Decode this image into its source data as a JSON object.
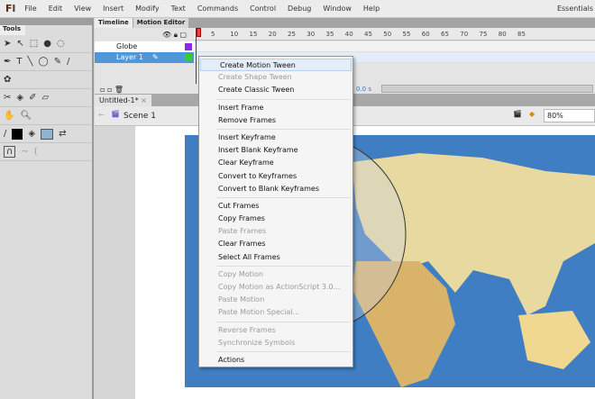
{
  "app": {
    "logo": "Fl",
    "workspace": "Essentials"
  },
  "menu": [
    "File",
    "Edit",
    "View",
    "Insert",
    "Modify",
    "Text",
    "Commands",
    "Control",
    "Debug",
    "Window",
    "Help"
  ],
  "tools": {
    "title": "Tools"
  },
  "timeline": {
    "tabs": [
      "Timeline",
      "Motion Editor"
    ],
    "ruler": [
      "1",
      "5",
      "10",
      "15",
      "20",
      "25",
      "30",
      "35",
      "40",
      "45",
      "50",
      "55",
      "60",
      "65",
      "70",
      "75",
      "80",
      "85"
    ],
    "layers": [
      {
        "name": "Globe",
        "color": "#8a2be2"
      },
      {
        "name": "Layer 1",
        "color": "#33cc33",
        "selected": true
      }
    ],
    "time": "0.0 s"
  },
  "document": {
    "tab": "Untitled-1*",
    "close": "×",
    "scene": "Scene 1",
    "zoom": "80%"
  },
  "context_menu": [
    [
      {
        "label": "Create Motion Tween",
        "highlighted": true
      },
      {
        "label": "Create Shape Tween",
        "disabled": true
      },
      {
        "label": "Create Classic Tween"
      }
    ],
    [
      {
        "label": "Insert Frame"
      },
      {
        "label": "Remove Frames"
      }
    ],
    [
      {
        "label": "Insert Keyframe"
      },
      {
        "label": "Insert Blank Keyframe"
      },
      {
        "label": "Clear Keyframe"
      },
      {
        "label": "Convert to Keyframes"
      },
      {
        "label": "Convert to Blank Keyframes"
      }
    ],
    [
      {
        "label": "Cut Frames"
      },
      {
        "label": "Copy Frames"
      },
      {
        "label": "Paste Frames",
        "disabled": true
      },
      {
        "label": "Clear Frames"
      },
      {
        "label": "Select All Frames"
      }
    ],
    [
      {
        "label": "Copy Motion",
        "disabled": true
      },
      {
        "label": "Copy Motion as ActionScript 3.0...",
        "disabled": true
      },
      {
        "label": "Paste Motion",
        "disabled": true
      },
      {
        "label": "Paste Motion Special...",
        "disabled": true
      }
    ],
    [
      {
        "label": "Reverse Frames",
        "disabled": true
      },
      {
        "label": "Synchronize Symbols",
        "disabled": true
      }
    ],
    [
      {
        "label": "Actions"
      }
    ]
  ]
}
